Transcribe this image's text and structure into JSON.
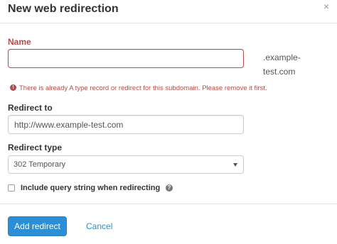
{
  "dialog": {
    "title": "New web redirection",
    "close_glyph": "×"
  },
  "name_field": {
    "label": "Name",
    "value": "",
    "placeholder": "",
    "suffix": ".example-test.com",
    "error": "There is already A type record or redirect for this subdomain. Please remove it first.",
    "error_icon": "!"
  },
  "redirect_to": {
    "label": "Redirect to",
    "value": "http://www.example-test.com"
  },
  "redirect_type": {
    "label": "Redirect type",
    "selected": "302 Temporary"
  },
  "query_string": {
    "label": "Include query string when redirecting",
    "checked": false,
    "help_glyph": "?"
  },
  "actions": {
    "submit_label": "Add redirect",
    "cancel_label": "Cancel"
  },
  "colors": {
    "error": "#b94a48",
    "primary": "#2a8fd6",
    "text": "#333333"
  },
  "icons": [
    "close-icon",
    "error-icon",
    "caret-down-icon",
    "help-icon"
  ]
}
